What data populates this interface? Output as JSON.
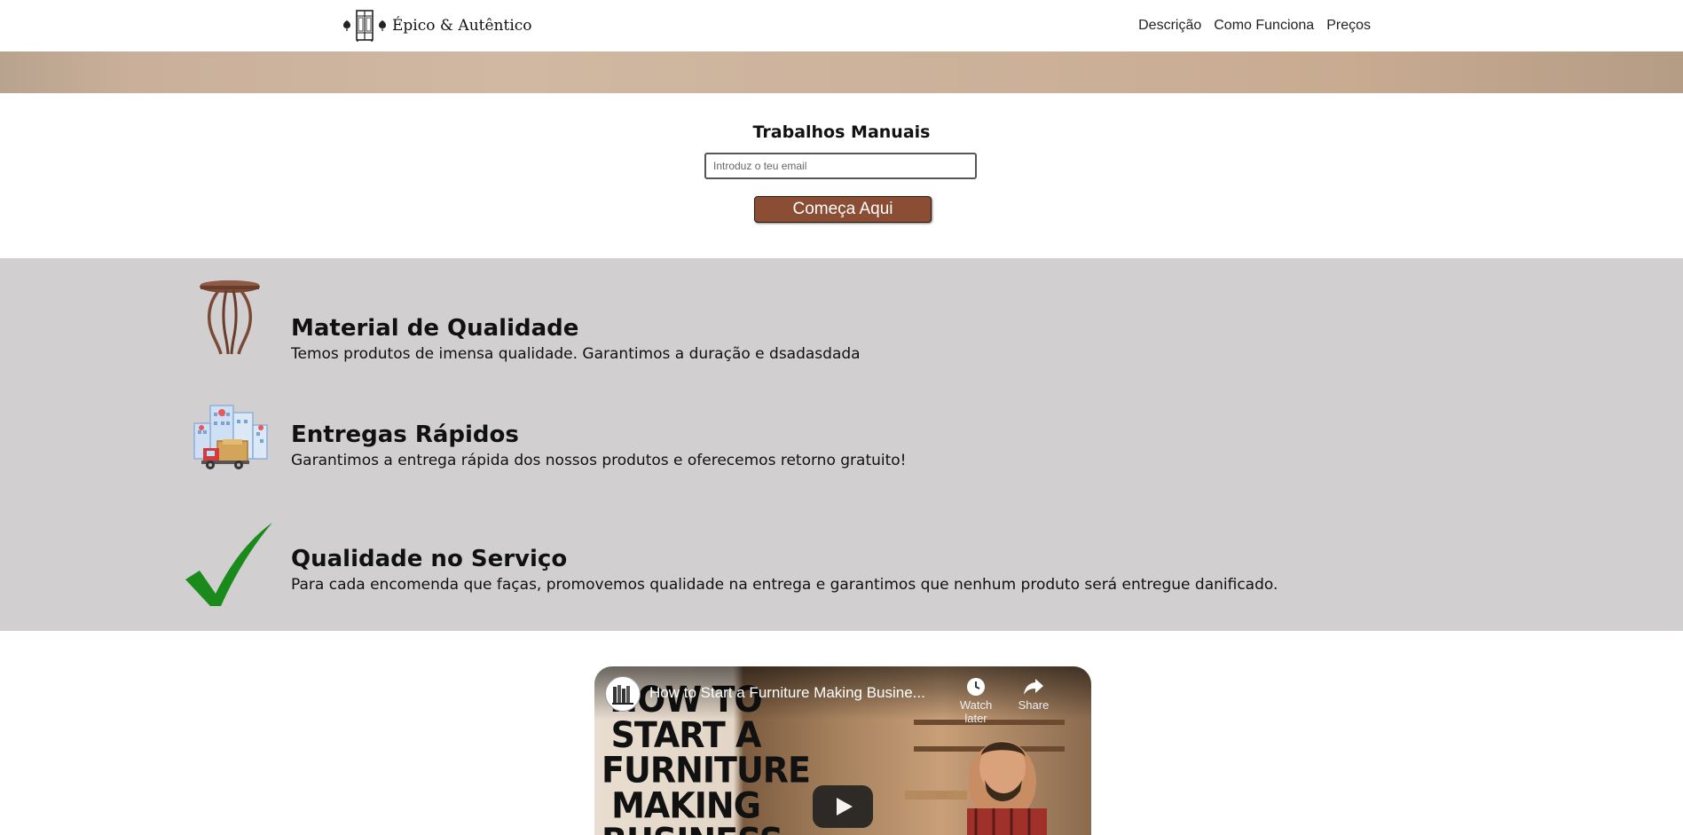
{
  "header": {
    "logo_text": "Épico & Autêntico",
    "nav": [
      "Descrição",
      "Como Funciona",
      "Preços"
    ]
  },
  "signup": {
    "title": "Trabalhos Manuais",
    "email_placeholder": "Introduz o teu email",
    "button_label": "Começa Aqui"
  },
  "features": [
    {
      "icon": "round-table-icon",
      "title": "Material de Qualidade",
      "description": "Temos produtos de imensa qualidade. Garantimos a duração e dsadasdada"
    },
    {
      "icon": "delivery-truck-icon",
      "title": "Entregas Rápidos",
      "description": "Garantimos a entrega rápida dos nossos produtos e oferecemos retorno gratuito!"
    },
    {
      "icon": "checkmark-icon",
      "title": "Qualidade no Serviço",
      "description": "Para cada encomenda que faças, promovemos qualidade na entrega e garantimos que nenhum produto será entregue danificado."
    }
  ],
  "video": {
    "title": "How to Start a Furniture Making Busine...",
    "thumbnail_text": "HOW TO START A FURNITURE MAKING BUSINESS",
    "watch_later_label": "Watch later",
    "share_label": "Share"
  },
  "colors": {
    "cta_background": "#8b4d34",
    "features_background": "#d1cfd0",
    "checkmark_green": "#1a8a1a"
  }
}
